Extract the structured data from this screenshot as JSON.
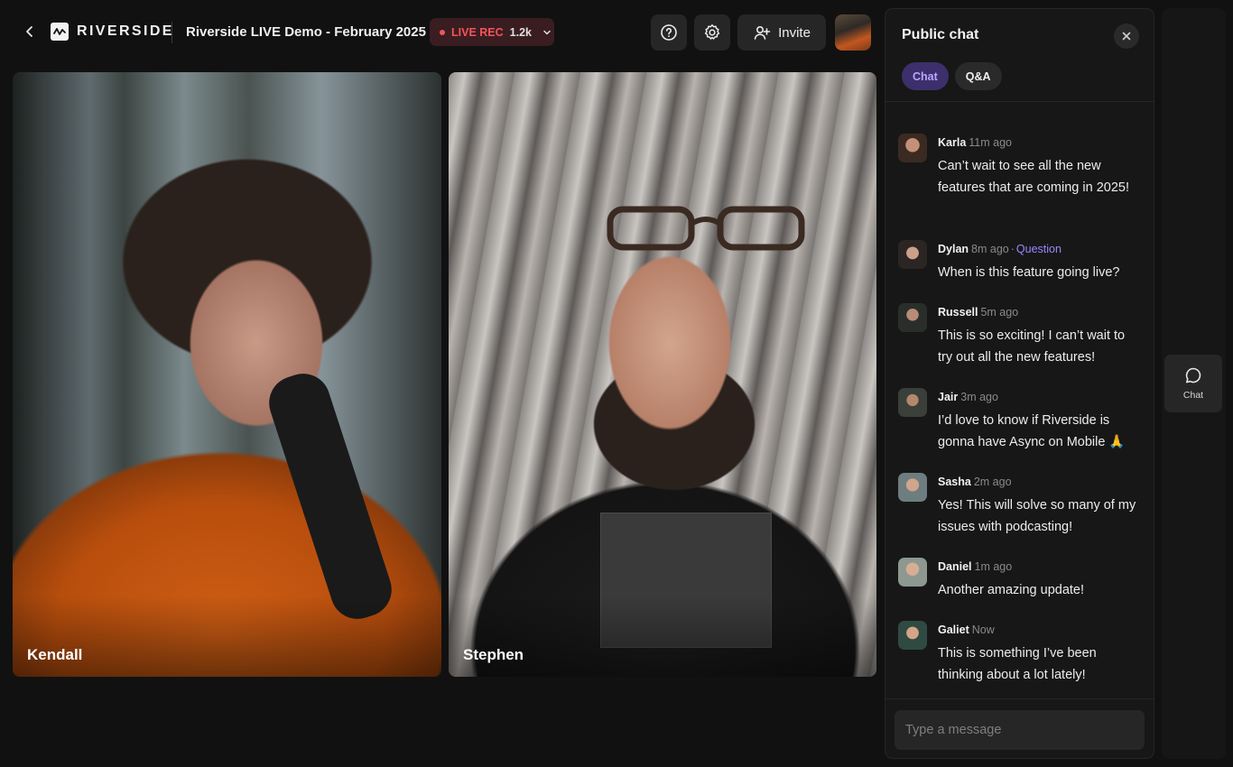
{
  "header": {
    "back_icon": "chevron-left-icon",
    "logo_text": "RIVERSIDE",
    "title": "Riverside LIVE Demo - February 2025",
    "live": {
      "label": "LIVE REC",
      "count": "1.2k",
      "color": "#f2545b"
    },
    "help_icon": "help-circle-icon",
    "settings_icon": "gear-icon",
    "invite_label": "Invite"
  },
  "participants": [
    {
      "name": "Kendall"
    },
    {
      "name": "Stephen"
    }
  ],
  "chat": {
    "title": "Public chat",
    "tabs": [
      {
        "label": "Chat",
        "active": true
      },
      {
        "label": "Q&A",
        "active": false
      }
    ],
    "messages": [
      {
        "name": "Karla",
        "time": "11m ago",
        "tag": "",
        "text": "Can’t wait to see all the new features that are coming in 2025!"
      },
      {
        "name": "Dylan",
        "time": "8m ago",
        "tag": "Question",
        "text": "When is this feature going live?"
      },
      {
        "name": "Russell",
        "time": "5m ago",
        "tag": "",
        "text": "This is so exciting! I can’t wait to try out all the new features!"
      },
      {
        "name": "Jair",
        "time": "3m ago",
        "tag": "",
        "text": "I’d love to know if Riverside is gonna have Async on Mobile 🙏"
      },
      {
        "name": "Sasha",
        "time": "2m ago",
        "tag": "",
        "text": "Yes! This will solve so many of my issues with podcasting!"
      },
      {
        "name": "Daniel",
        "time": "1m ago",
        "tag": "",
        "text": "Another amazing update!"
      },
      {
        "name": "Galiet",
        "time": "Now",
        "tag": "",
        "text": "This is something I’ve been thinking about a lot lately!"
      }
    ],
    "composer": {
      "placeholder": "Type a message"
    },
    "accent_color": "#9b86ff"
  },
  "rail": {
    "chat_label": "Chat",
    "chat_icon": "chat-bubble-icon"
  }
}
